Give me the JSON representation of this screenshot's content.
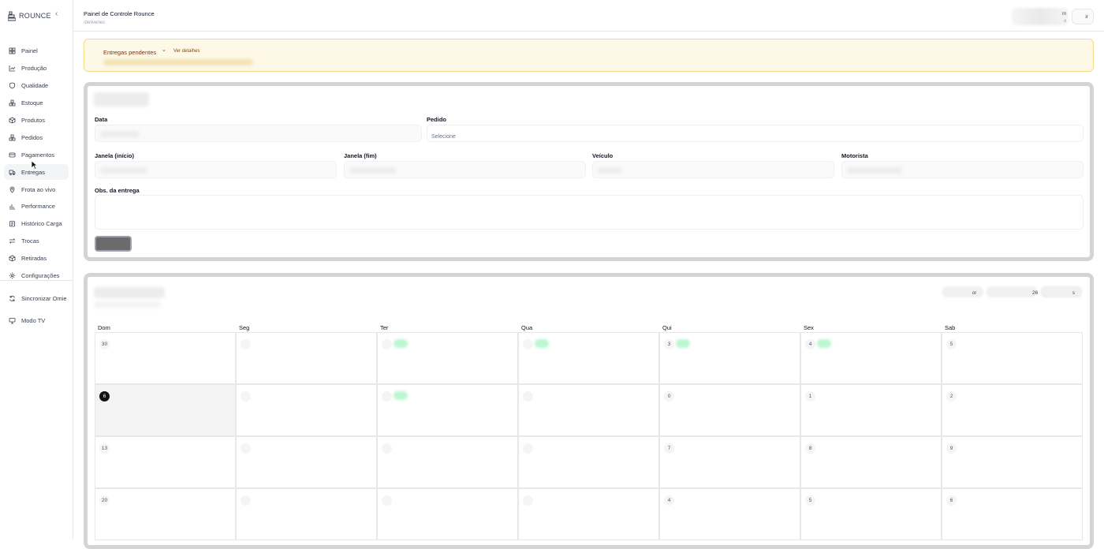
{
  "brand": {
    "name": "ROUNCE",
    "collapse_icon": "chevron-left-icon"
  },
  "sidebar": {
    "items": [
      {
        "label": "Painel",
        "icon": "grid-icon"
      },
      {
        "label": "Produção",
        "icon": "chart-icon"
      },
      {
        "label": "Qualidade",
        "icon": "shield-icon"
      },
      {
        "label": "Estoque",
        "icon": "boxes-icon"
      },
      {
        "label": "Produtos",
        "icon": "package-icon"
      },
      {
        "label": "Pedidos",
        "icon": "boxes-icon"
      },
      {
        "label": "Pagamentos",
        "icon": "card-icon"
      },
      {
        "label": "Entregas",
        "icon": "truck-icon",
        "active": true
      },
      {
        "label": "Frota ao vivo",
        "icon": "pin-icon"
      },
      {
        "label": "Performance",
        "icon": "bars-icon"
      },
      {
        "label": "Histórico Carga",
        "icon": "clipboard-icon"
      },
      {
        "label": "Trocas",
        "icon": "swap-icon"
      },
      {
        "label": "Retiradas",
        "icon": "package-icon"
      },
      {
        "label": "Configurações",
        "icon": "gear-icon"
      }
    ],
    "footer": [
      {
        "label": "Sincronizar Omie",
        "icon": "refresh-icon"
      },
      {
        "label": "Modo TV",
        "icon": "monitor-icon"
      }
    ]
  },
  "header": {
    "title": "Painel de Controle Rounce",
    "path": "/deliveries",
    "user_letter": "m",
    "user_sub": "d",
    "logout_label": "ir"
  },
  "alert": {
    "label": "Entregas pendentes",
    "link": "Ver detalhes"
  },
  "form": {
    "labels": {
      "data": "Data",
      "pedido": "Pedido",
      "janela_inicio": "Janela (início)",
      "janela_fim": "Janela (fim)",
      "veiculo": "Veículo",
      "motorista": "Motorista",
      "obs": "Obs. da entrega"
    },
    "pedido_placeholder": "Selecione"
  },
  "calendar": {
    "weekdays": [
      "Dom",
      "Seg",
      "Ter",
      "Qua",
      "Qui",
      "Sex",
      "Sab"
    ],
    "controls": {
      "prev_suffix": "or",
      "month_suffix": "26",
      "next_suffix": "s"
    },
    "weeks": [
      [
        {
          "n": "30"
        },
        {
          "n": ""
        },
        {
          "n": "",
          "g": true
        },
        {
          "n": "",
          "g": true
        },
        {
          "n": "3",
          "g": true
        },
        {
          "n": "4",
          "g": true
        },
        {
          "n": "5"
        }
      ],
      [
        {
          "n": "6",
          "today": true
        },
        {
          "n": ""
        },
        {
          "n": "",
          "g": true
        },
        {
          "n": ""
        },
        {
          "n": "0"
        },
        {
          "n": "1"
        },
        {
          "n": "2"
        }
      ],
      [
        {
          "n": "13"
        },
        {
          "n": ""
        },
        {
          "n": ""
        },
        {
          "n": ""
        },
        {
          "n": "7"
        },
        {
          "n": "8"
        },
        {
          "n": "9"
        }
      ],
      [
        {
          "n": "20"
        },
        {
          "n": ""
        },
        {
          "n": ""
        },
        {
          "n": ""
        },
        {
          "n": "4"
        },
        {
          "n": "5"
        },
        {
          "n": "6"
        }
      ]
    ]
  }
}
